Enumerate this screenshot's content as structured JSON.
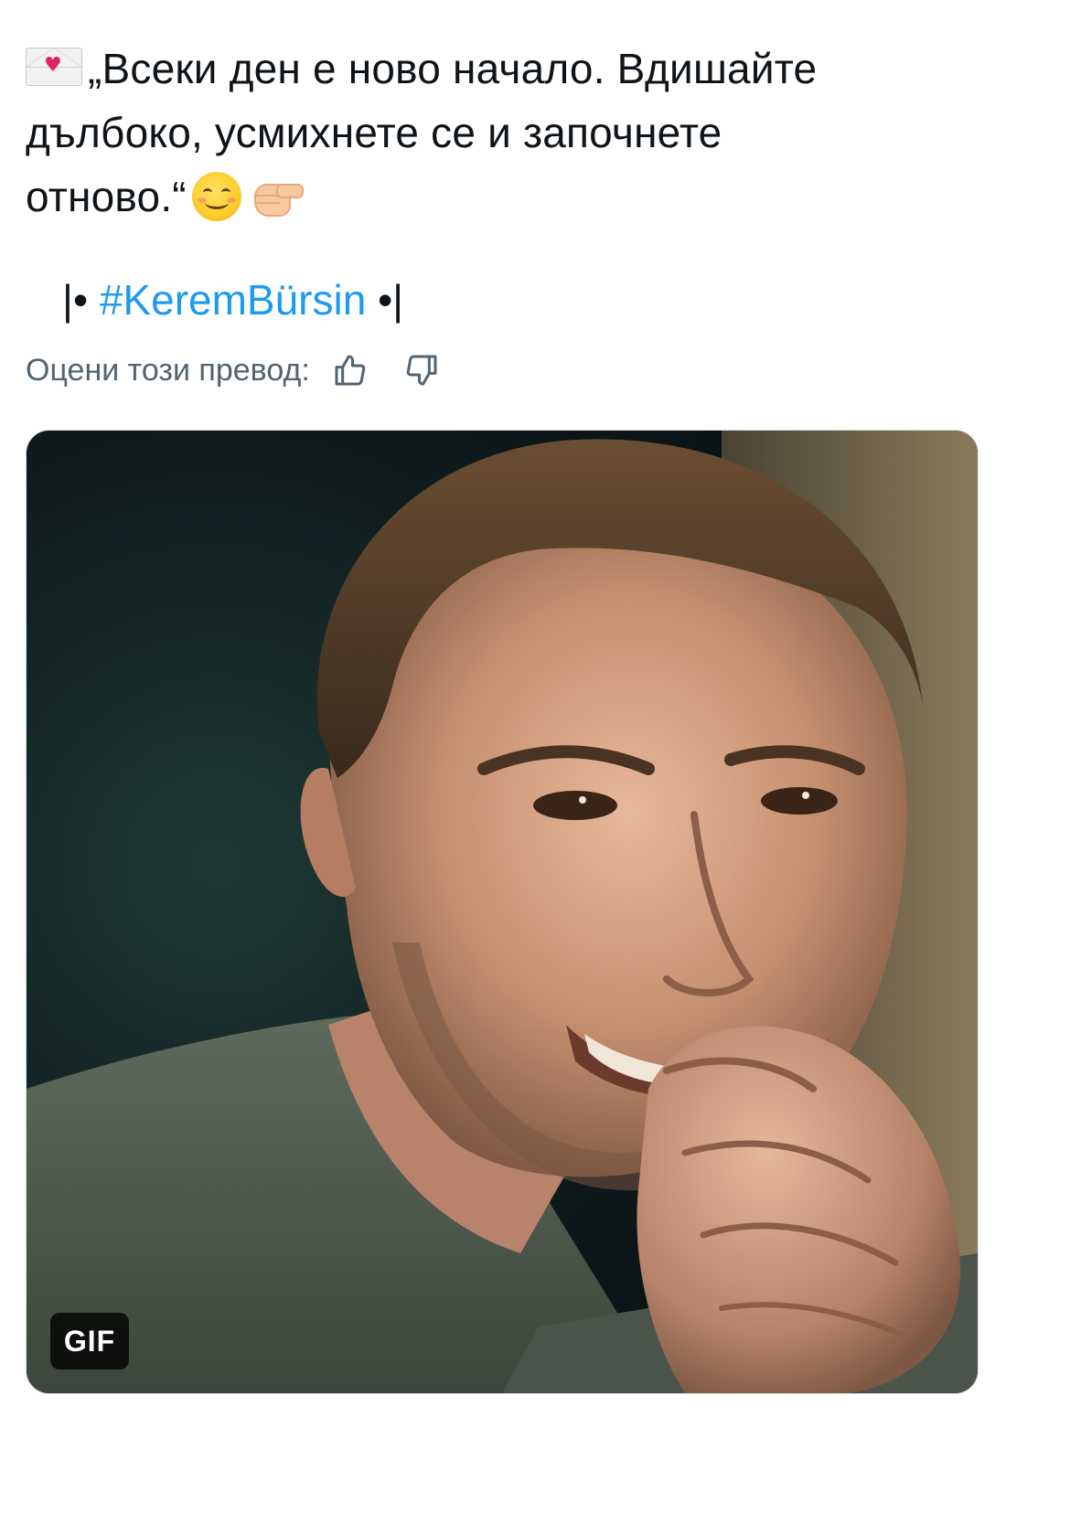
{
  "tweet": {
    "line1": "„Всеки ден е ново начало. Вдишайте",
    "line2": "дълбоко, усмихнете се и започнете",
    "line3": "отново.“",
    "hashtag_prefix": "|• ",
    "hashtag": "#KeremBürsin",
    "hashtag_suffix": " •|",
    "emojis": [
      "love-letter-icon",
      "smiling-face-icon",
      "pointing-fist-icon"
    ]
  },
  "translation_rating": {
    "label": "Оцени този превод:",
    "like_icon": "thumbs-up-icon",
    "dislike_icon": "thumbs-down-icon"
  },
  "media": {
    "type": "gif",
    "badge": "GIF",
    "description_icon": "gif-image"
  },
  "colors": {
    "text": "#0f1419",
    "link": "#1d9bf0",
    "secondary": "#536471"
  }
}
